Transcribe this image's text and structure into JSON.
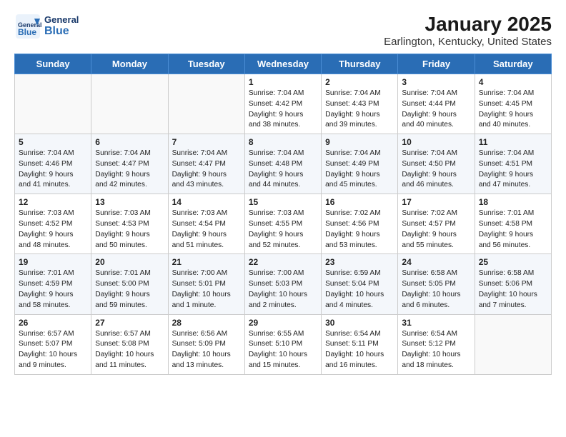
{
  "header": {
    "logo_general": "General",
    "logo_blue": "Blue",
    "month": "January 2025",
    "location": "Earlington, Kentucky, United States"
  },
  "weekdays": [
    "Sunday",
    "Monday",
    "Tuesday",
    "Wednesday",
    "Thursday",
    "Friday",
    "Saturday"
  ],
  "weeks": [
    [
      {
        "day": "",
        "info": ""
      },
      {
        "day": "",
        "info": ""
      },
      {
        "day": "",
        "info": ""
      },
      {
        "day": "1",
        "info": "Sunrise: 7:04 AM\nSunset: 4:42 PM\nDaylight: 9 hours\nand 38 minutes."
      },
      {
        "day": "2",
        "info": "Sunrise: 7:04 AM\nSunset: 4:43 PM\nDaylight: 9 hours\nand 39 minutes."
      },
      {
        "day": "3",
        "info": "Sunrise: 7:04 AM\nSunset: 4:44 PM\nDaylight: 9 hours\nand 40 minutes."
      },
      {
        "day": "4",
        "info": "Sunrise: 7:04 AM\nSunset: 4:45 PM\nDaylight: 9 hours\nand 40 minutes."
      }
    ],
    [
      {
        "day": "5",
        "info": "Sunrise: 7:04 AM\nSunset: 4:46 PM\nDaylight: 9 hours\nand 41 minutes."
      },
      {
        "day": "6",
        "info": "Sunrise: 7:04 AM\nSunset: 4:47 PM\nDaylight: 9 hours\nand 42 minutes."
      },
      {
        "day": "7",
        "info": "Sunrise: 7:04 AM\nSunset: 4:47 PM\nDaylight: 9 hours\nand 43 minutes."
      },
      {
        "day": "8",
        "info": "Sunrise: 7:04 AM\nSunset: 4:48 PM\nDaylight: 9 hours\nand 44 minutes."
      },
      {
        "day": "9",
        "info": "Sunrise: 7:04 AM\nSunset: 4:49 PM\nDaylight: 9 hours\nand 45 minutes."
      },
      {
        "day": "10",
        "info": "Sunrise: 7:04 AM\nSunset: 4:50 PM\nDaylight: 9 hours\nand 46 minutes."
      },
      {
        "day": "11",
        "info": "Sunrise: 7:04 AM\nSunset: 4:51 PM\nDaylight: 9 hours\nand 47 minutes."
      }
    ],
    [
      {
        "day": "12",
        "info": "Sunrise: 7:03 AM\nSunset: 4:52 PM\nDaylight: 9 hours\nand 48 minutes."
      },
      {
        "day": "13",
        "info": "Sunrise: 7:03 AM\nSunset: 4:53 PM\nDaylight: 9 hours\nand 50 minutes."
      },
      {
        "day": "14",
        "info": "Sunrise: 7:03 AM\nSunset: 4:54 PM\nDaylight: 9 hours\nand 51 minutes."
      },
      {
        "day": "15",
        "info": "Sunrise: 7:03 AM\nSunset: 4:55 PM\nDaylight: 9 hours\nand 52 minutes."
      },
      {
        "day": "16",
        "info": "Sunrise: 7:02 AM\nSunset: 4:56 PM\nDaylight: 9 hours\nand 53 minutes."
      },
      {
        "day": "17",
        "info": "Sunrise: 7:02 AM\nSunset: 4:57 PM\nDaylight: 9 hours\nand 55 minutes."
      },
      {
        "day": "18",
        "info": "Sunrise: 7:01 AM\nSunset: 4:58 PM\nDaylight: 9 hours\nand 56 minutes."
      }
    ],
    [
      {
        "day": "19",
        "info": "Sunrise: 7:01 AM\nSunset: 4:59 PM\nDaylight: 9 hours\nand 58 minutes."
      },
      {
        "day": "20",
        "info": "Sunrise: 7:01 AM\nSunset: 5:00 PM\nDaylight: 9 hours\nand 59 minutes."
      },
      {
        "day": "21",
        "info": "Sunrise: 7:00 AM\nSunset: 5:01 PM\nDaylight: 10 hours\nand 1 minute."
      },
      {
        "day": "22",
        "info": "Sunrise: 7:00 AM\nSunset: 5:03 PM\nDaylight: 10 hours\nand 2 minutes."
      },
      {
        "day": "23",
        "info": "Sunrise: 6:59 AM\nSunset: 5:04 PM\nDaylight: 10 hours\nand 4 minutes."
      },
      {
        "day": "24",
        "info": "Sunrise: 6:58 AM\nSunset: 5:05 PM\nDaylight: 10 hours\nand 6 minutes."
      },
      {
        "day": "25",
        "info": "Sunrise: 6:58 AM\nSunset: 5:06 PM\nDaylight: 10 hours\nand 7 minutes."
      }
    ],
    [
      {
        "day": "26",
        "info": "Sunrise: 6:57 AM\nSunset: 5:07 PM\nDaylight: 10 hours\nand 9 minutes."
      },
      {
        "day": "27",
        "info": "Sunrise: 6:57 AM\nSunset: 5:08 PM\nDaylight: 10 hours\nand 11 minutes."
      },
      {
        "day": "28",
        "info": "Sunrise: 6:56 AM\nSunset: 5:09 PM\nDaylight: 10 hours\nand 13 minutes."
      },
      {
        "day": "29",
        "info": "Sunrise: 6:55 AM\nSunset: 5:10 PM\nDaylight: 10 hours\nand 15 minutes."
      },
      {
        "day": "30",
        "info": "Sunrise: 6:54 AM\nSunset: 5:11 PM\nDaylight: 10 hours\nand 16 minutes."
      },
      {
        "day": "31",
        "info": "Sunrise: 6:54 AM\nSunset: 5:12 PM\nDaylight: 10 hours\nand 18 minutes."
      },
      {
        "day": "",
        "info": ""
      }
    ]
  ]
}
